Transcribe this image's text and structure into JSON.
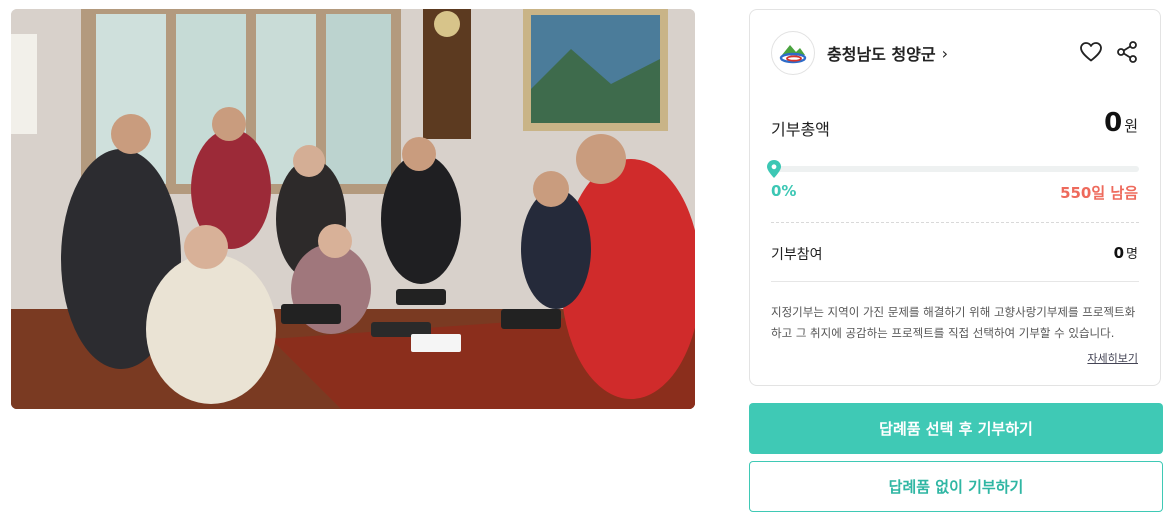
{
  "project": {
    "image_alt": "",
    "org_name": "충청남도 청양군",
    "org_chevron": "›"
  },
  "icons": {
    "favorite": "heart-icon",
    "share": "share-icon",
    "logo": "cheongyang-logo"
  },
  "summary": {
    "total_label": "기부총액",
    "total_value": "0",
    "total_unit": "원",
    "progress_percent": 0,
    "progress_label": "0%",
    "days_left": "550일 남음",
    "participants_label": "기부참여",
    "participants_value": "0",
    "participants_unit": "명",
    "description": "지정기부는 지역이 가진 문제를 해결하기 위해 고향사랑기부제를 프로젝트화 하고 그 취지에 공감하는 프로젝트를 직접 선택하여 기부할 수 있습니다.",
    "more_link": "자세히보기"
  },
  "actions": {
    "primary": "답례품 선택 후 기부하기",
    "secondary": "답례품 없이 기부하기"
  },
  "colors": {
    "accent": "#3fc9b5",
    "days": "#ee6a5c"
  }
}
